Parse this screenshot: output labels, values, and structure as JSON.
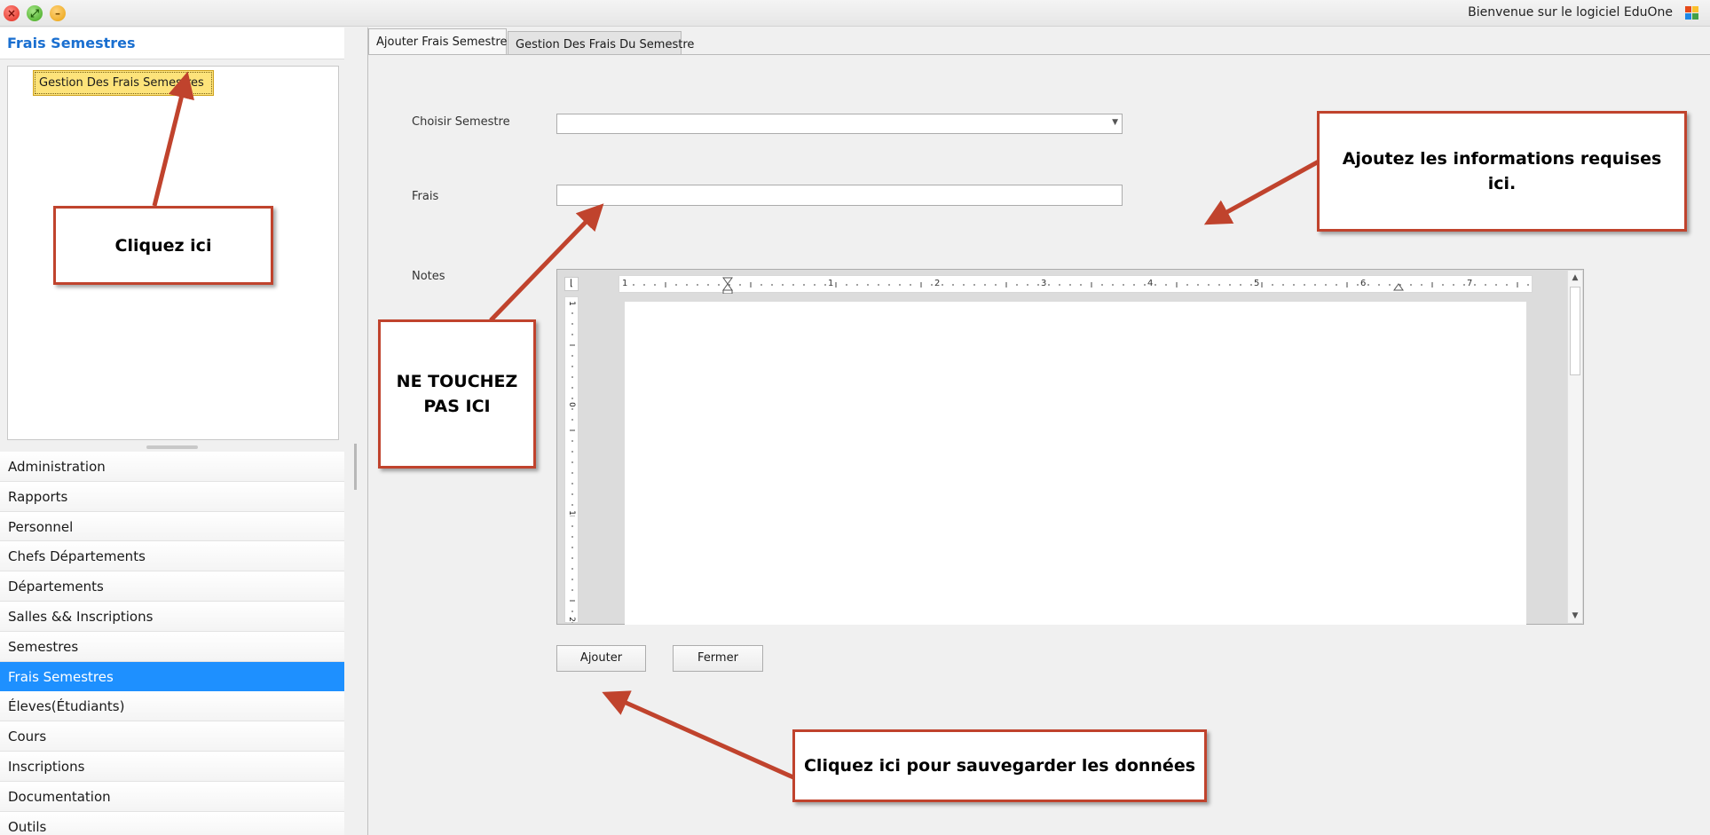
{
  "window": {
    "title": "Bienvenue sur le logiciel EduOne",
    "buttons": {
      "close_glyph": "×",
      "maximize_glyph": "⤢",
      "minimize_glyph": "–"
    }
  },
  "sidebar": {
    "header": "Frais Semestres",
    "tree_item": "Gestion Des Frais Semestres",
    "nav_items": [
      {
        "label": "Administration",
        "active": false
      },
      {
        "label": "Rapports",
        "active": false
      },
      {
        "label": "Personnel",
        "active": false
      },
      {
        "label": "Chefs Départements",
        "active": false
      },
      {
        "label": "Départements",
        "active": false
      },
      {
        "label": "Salles && Inscriptions",
        "active": false
      },
      {
        "label": "Semestres",
        "active": false
      },
      {
        "label": "Frais Semestres",
        "active": true
      },
      {
        "label": "Éleves(Étudiants)",
        "active": false
      },
      {
        "label": "Cours",
        "active": false
      },
      {
        "label": "Inscriptions",
        "active": false
      },
      {
        "label": "Documentation",
        "active": false
      },
      {
        "label": "Outils",
        "active": false
      }
    ]
  },
  "tabs": [
    {
      "label": "Ajouter Frais Semestre",
      "active": true
    },
    {
      "label": "Gestion Des Frais Du Semestre",
      "active": false
    }
  ],
  "form": {
    "semestre_label": "Choisir Semestre",
    "semestre_value": "",
    "frais_label": "Frais",
    "frais_value": "",
    "notes_label": "Notes",
    "ruler_numbers": [
      "1",
      "1",
      "2",
      "3",
      "4",
      "5",
      "6",
      "7"
    ],
    "vruler_numbers": [
      "1",
      "0",
      "1",
      "2"
    ],
    "add_button": "Ajouter",
    "close_button": "Fermer"
  },
  "annotations": {
    "cliquez_ici": "Cliquez ici",
    "ajoutez_infos": "Ajoutez les informations requises ici.",
    "ne_touchez_pas": "NE TOUCHEZ PAS ICI",
    "sauvegarder": "Cliquez ici pour sauvegarder les données"
  },
  "colors": {
    "accent": "#1e90ff",
    "header_text": "#1a6fd0",
    "annotation_border": "#c0432d",
    "tree_selected": "#fde37a"
  }
}
